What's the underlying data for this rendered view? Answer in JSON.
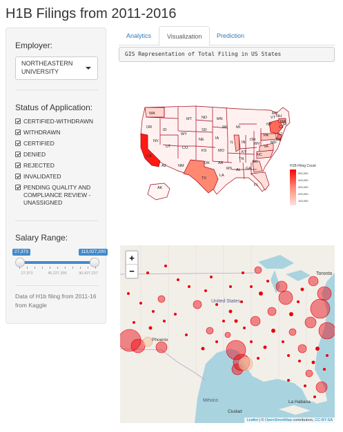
{
  "page": {
    "title": "H1B Filings from 2011-2016"
  },
  "sidebar": {
    "employer_label": "Employer:",
    "employer_value": "NORTHEASTERN UNIVERSITY",
    "status_label": "Status of Application:",
    "statuses": [
      "CERTIFIED-WITHDRAWN",
      "WITHDRAWN",
      "CERTIFIED",
      "DENIED",
      "REJECTED",
      "INVALIDATED",
      "PENDING QUALITY AND COMPLIANCE REVIEW - UNASSIGNED"
    ],
    "salary_label": "Salary Range:",
    "salary_min": "27,373",
    "salary_max": "113,027,200",
    "salary_ticks": [
      "27,373",
      "45,227,305",
      "90,427,237"
    ],
    "help_text": "Data of H1b filing from 2011-16 from Kaggle"
  },
  "tabs": [
    {
      "label": "Analytics",
      "active": false
    },
    {
      "label": "Visualization",
      "active": true
    },
    {
      "label": "Prediction",
      "active": false
    }
  ],
  "verbatim": "GIS Representation of Total Filing in US States",
  "state_map": {
    "legend_title": "H1B Filing Count",
    "legend_labels": [
      "500,000",
      "400,000",
      "300,000",
      "200,000",
      "100,000"
    ],
    "states": [
      "WA",
      "MT",
      "ND",
      "MN",
      "ME",
      "OR",
      "ID",
      "SD",
      "WI",
      "MI",
      "NY",
      "VT",
      "NH",
      "MA",
      "WY",
      "IA",
      "NE",
      "NV",
      "UT",
      "IL",
      "IN",
      "OH",
      "PA",
      "NJ",
      "CO",
      "KS",
      "MO",
      "KY",
      "WV",
      "VA",
      "CT",
      "RI",
      "DE",
      "MD",
      "CA",
      "AZ",
      "NM",
      "OK",
      "AR",
      "TN",
      "NC",
      "TX",
      "MS",
      "AL",
      "GA",
      "SC",
      "LA",
      "AK",
      "FL"
    ]
  },
  "leaflet": {
    "zoom_in": "+",
    "zoom_out": "−",
    "place_labels": [
      "United States",
      "Toronto",
      "Phoenix",
      "México",
      "La Habana",
      "Ciudad"
    ],
    "attribution_leaflet": "Leaflet",
    "attribution_mid": " | © ",
    "attribution_osm": "OpenStreetMap",
    "attribution_contrib": " contributors, ",
    "attribution_license": "CC-BY-SA"
  },
  "colors": {
    "accent": "#428bca",
    "link": "#337ab7",
    "map_red": "#e8000b"
  }
}
